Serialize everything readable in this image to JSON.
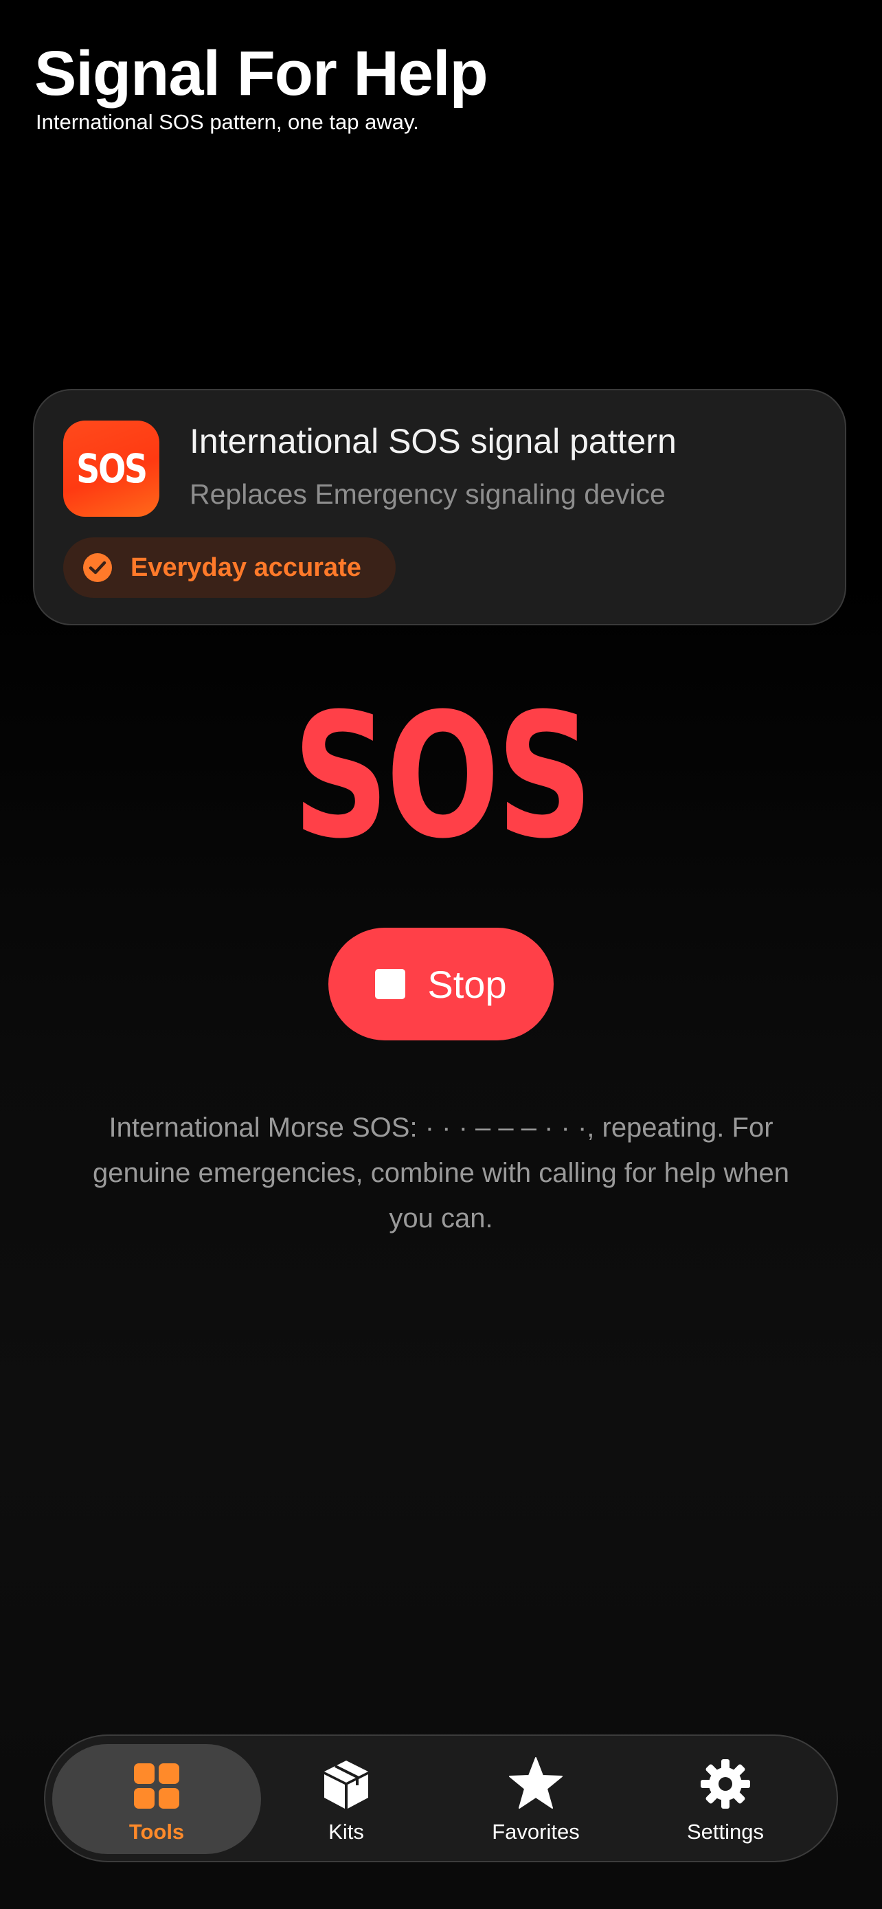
{
  "header": {
    "title": "Signal For Help",
    "subtitle": "International SOS pattern, one tap away."
  },
  "card": {
    "icon_text": "SOS",
    "title": "International SOS signal pattern",
    "subtitle": "Replaces Emergency signaling device",
    "badge": {
      "icon": "checkmark-circle-icon",
      "label": "Everyday accurate"
    }
  },
  "main": {
    "sos_text": "SOS",
    "stop_button": {
      "icon": "stop-icon",
      "label": "Stop"
    },
    "info": "International Morse SOS: · · · – – – · · ·, repeating. For genuine emergencies, combine with calling for help when you can."
  },
  "tabbar": {
    "tabs": [
      {
        "label": "Tools",
        "icon": "grid-icon",
        "active": true
      },
      {
        "label": "Kits",
        "icon": "box-icon",
        "active": false
      },
      {
        "label": "Favorites",
        "icon": "star-icon",
        "active": false
      },
      {
        "label": "Settings",
        "icon": "gear-icon",
        "active": false
      }
    ]
  },
  "colors": {
    "accent": "#ff4048",
    "tab_active": "#ff8a2a",
    "badge_text": "#ff7a2a",
    "badge_bg": "#3a2218",
    "card_bg": "#1e1e1e"
  }
}
